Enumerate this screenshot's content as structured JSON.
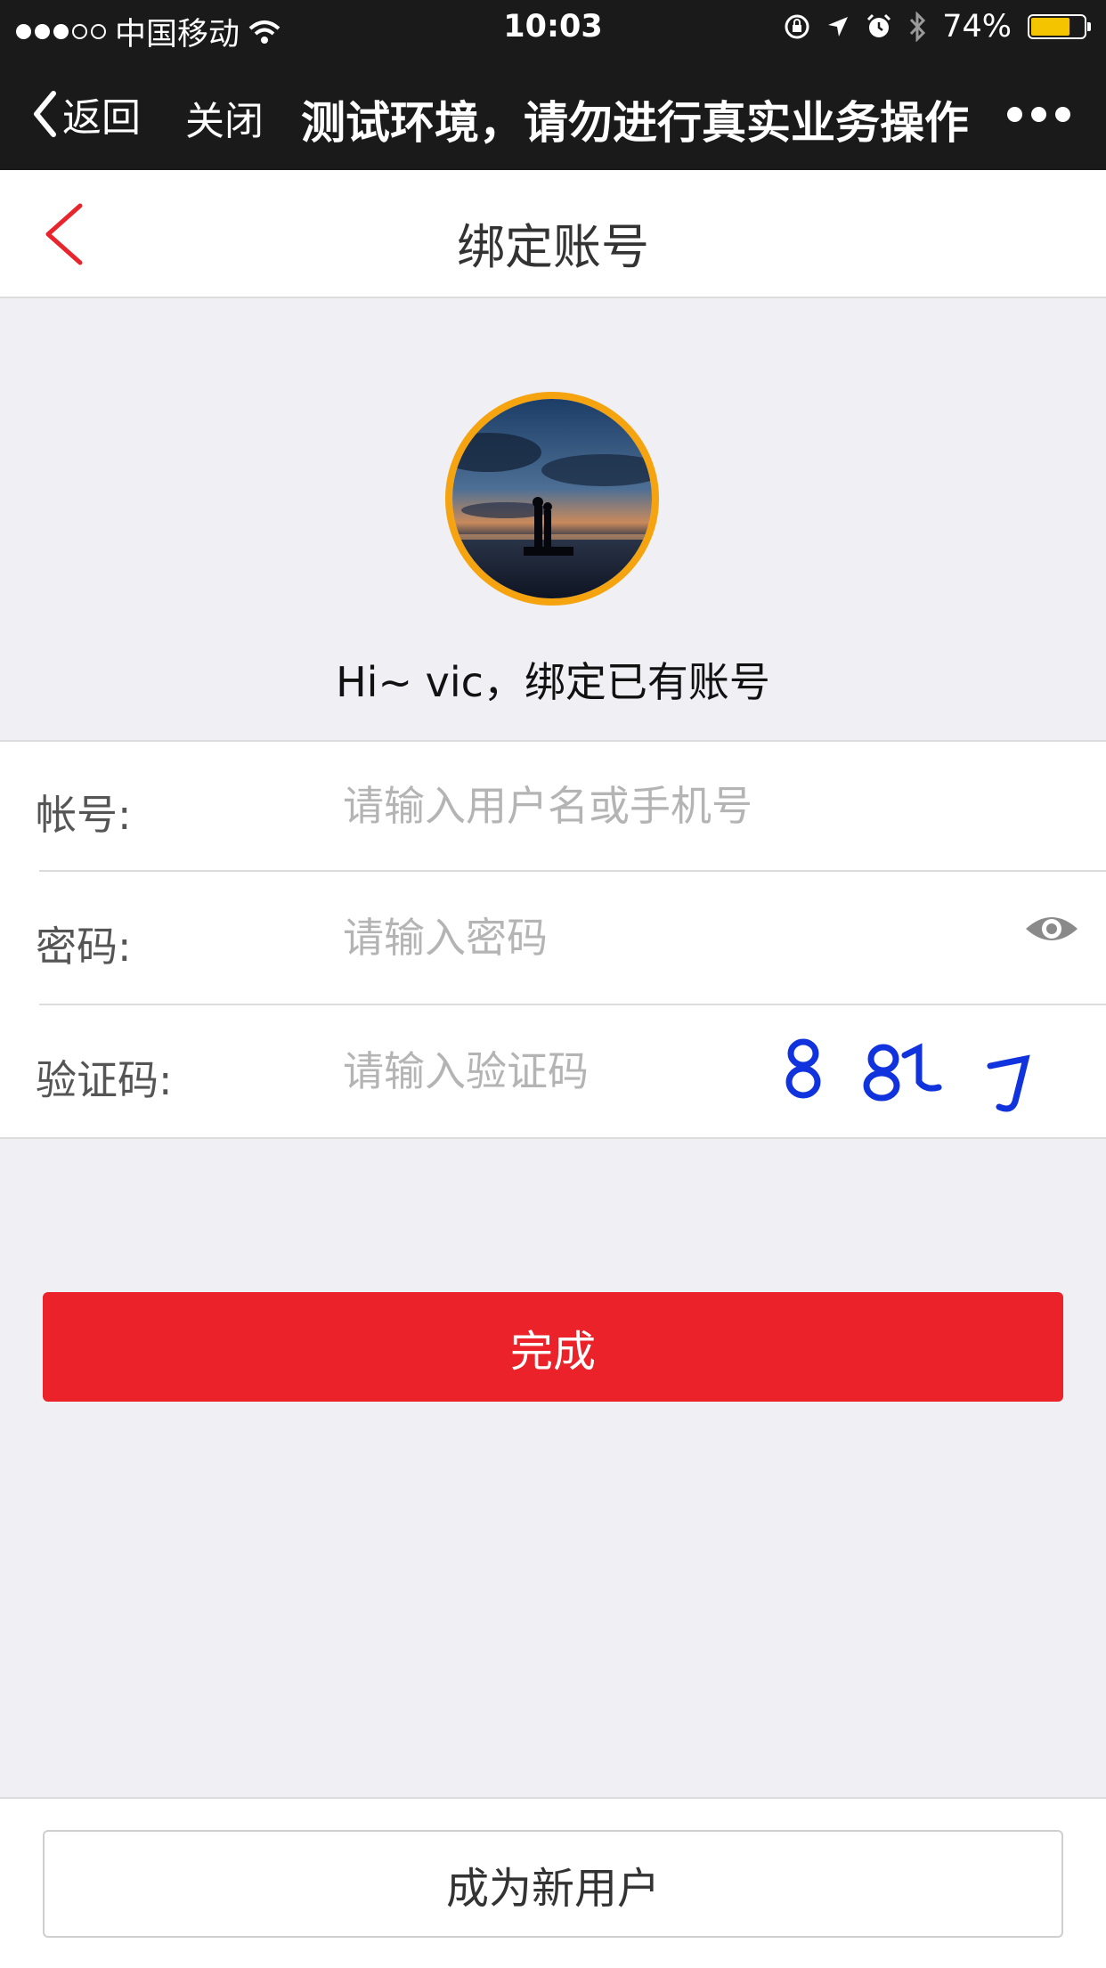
{
  "status_bar": {
    "carrier": "中国移动",
    "time": "10:03",
    "battery_percent": "74%",
    "battery_level": 0.74,
    "signal_filled": 3,
    "signal_total": 5,
    "colors": {
      "background": "#1a1a1a",
      "battery": "#f5c400"
    }
  },
  "wechat_nav": {
    "back_label": "返回",
    "close_label": "关闭",
    "title": "测试环境，请勿进行真实业务操作",
    "more_icon": "more-dots-icon"
  },
  "header": {
    "title": "绑定账号",
    "back_icon": "chevron-left-icon",
    "accent_color": "#e8242c"
  },
  "profile": {
    "avatar": "user-avatar",
    "avatar_border_color": "#f5a30e",
    "greeting": "Hi~ vic，绑定已有账号"
  },
  "form": {
    "account": {
      "label": "帐号:",
      "placeholder": "请输入用户名或手机号",
      "value": ""
    },
    "password": {
      "label": "密码:",
      "placeholder": "请输入密码",
      "value": "",
      "toggle_icon": "eye-icon"
    },
    "captcha": {
      "label": "验证码:",
      "placeholder": "请输入验证码",
      "value": "",
      "image_text": "8817"
    }
  },
  "actions": {
    "done_label": "完成",
    "done_color": "#eb2229",
    "new_user_label": "成为新用户"
  }
}
